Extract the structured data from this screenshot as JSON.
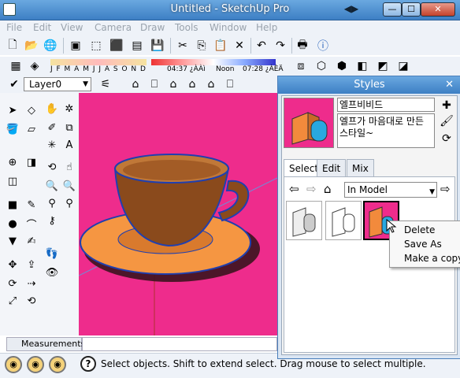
{
  "window": {
    "title": "Untitled - SketchUp Pro",
    "min_label": "—",
    "max_label": "☐",
    "close_label": "✕"
  },
  "menus": [
    {
      "label": "File"
    },
    {
      "label": "Edit"
    },
    {
      "label": "View"
    },
    {
      "label": "Camera"
    },
    {
      "label": "Draw"
    },
    {
      "label": "Tools"
    },
    {
      "label": "Window"
    },
    {
      "label": "Help"
    }
  ],
  "shadow_bar": {
    "months": "J F M A M J J A S O N D",
    "time_start": "04:37 ¿ÀÀì",
    "noon": "Noon",
    "time_end": "07:28 ¿ÀÈÄ"
  },
  "layer_bar": {
    "layer_name": "Layer0"
  },
  "measurements": {
    "label": "Measurements",
    "value": ""
  },
  "status": {
    "text": "Select objects. Shift to extend select. Drag mouse to select multiple."
  },
  "styles_panel": {
    "title": "Styles",
    "style_name": "엘프비비드",
    "style_desc": "엘프가 마음대로 만든 스타일~",
    "tabs": [
      {
        "label": "Select",
        "active": true
      },
      {
        "label": "Edit",
        "active": false
      },
      {
        "label": "Mix",
        "active": false
      }
    ],
    "collection": "In Model"
  },
  "context_menu": {
    "items": [
      {
        "label": "Delete"
      },
      {
        "label": "Save As"
      },
      {
        "label": "Make a copy"
      }
    ]
  },
  "colors": {
    "viewport_bg": "#ee2c8c",
    "title_blue": "#3d7fc4",
    "cup": "#8a4a1c",
    "saucer": "#f59642",
    "edge": "#1f3fb0"
  },
  "icons": {
    "toolbar_row1": [
      "new-icon",
      "open-icon",
      "save-icon",
      "cut-icon",
      "copy-icon",
      "paste-icon",
      "erase-icon",
      "undo-icon",
      "redo-icon",
      "print-icon",
      "model-info-icon"
    ],
    "toolbar_row2": [
      "shadow-toggle-icon",
      "fog-icon"
    ],
    "view_icons": [
      "iso-icon",
      "top-icon",
      "front-icon",
      "right-icon",
      "back-icon",
      "left-icon"
    ],
    "style_icons": [
      "xray-icon",
      "wireframe-icon",
      "hidden-line-icon",
      "shaded-icon",
      "shaded-texture-icon",
      "monochrome-icon"
    ]
  }
}
